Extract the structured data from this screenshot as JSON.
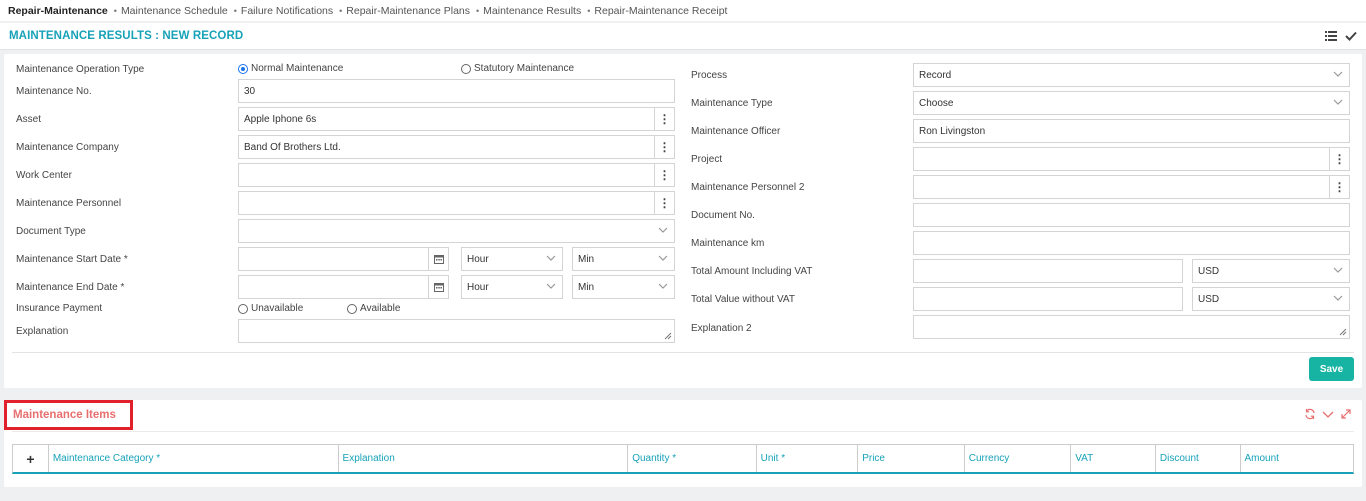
{
  "breadcrumbs": [
    {
      "label": "Repair-Maintenance"
    },
    {
      "label": "Maintenance Schedule"
    },
    {
      "label": "Failure Notifications"
    },
    {
      "label": "Repair-Maintenance Plans"
    },
    {
      "label": "Maintenance Results"
    },
    {
      "label": "Repair-Maintenance Receipt"
    }
  ],
  "header": {
    "title": "MAINTENANCE RESULTS : NEW RECORD"
  },
  "form": {
    "op_type_label": "Maintenance Operation Type",
    "op_type_normal": "Normal Maintenance",
    "op_type_statutory": "Statutory Maintenance",
    "maint_no_label": "Maintenance No.",
    "maint_no_value": "30",
    "asset_label": "Asset",
    "asset_value": "Apple Iphone 6s",
    "company_label": "Maintenance Company",
    "company_value": "Band Of Brothers Ltd.",
    "work_center_label": "Work Center",
    "personnel_label": "Maintenance Personnel",
    "doc_type_label": "Document Type",
    "start_date_label": "Maintenance Start Date *",
    "end_date_label": "Maintenance End Date *",
    "hour_placeholder": "Hour",
    "min_placeholder": "Min",
    "insurance_label": "Insurance Payment",
    "insurance_unavailable": "Unavailable",
    "insurance_available": "Available",
    "explanation_label": "Explanation",
    "process_label": "Process",
    "process_value": "Record",
    "maint_type_label": "Maintenance Type",
    "maint_type_value": "Choose",
    "officer_label": "Maintenance Officer",
    "officer_value": "Ron Livingston",
    "project_label": "Project",
    "personnel2_label": "Maintenance Personnel 2",
    "doc_no_label": "Document No.",
    "km_label": "Maintenance km",
    "total_vat_label": "Total Amount Including VAT",
    "total_novat_label": "Total Value without VAT",
    "currency_value": "USD",
    "explanation2_label": "Explanation 2",
    "save_label": "Save"
  },
  "items": {
    "title": "Maintenance Items",
    "columns": [
      {
        "label": "Maintenance Category *"
      },
      {
        "label": "Explanation"
      },
      {
        "label": "Quantity *"
      },
      {
        "label": "Unit *"
      },
      {
        "label": "Price"
      },
      {
        "label": "Currency"
      },
      {
        "label": "VAT"
      },
      {
        "label": "Discount"
      },
      {
        "label": "Amount"
      }
    ]
  },
  "colors": {
    "accent": "#17a2b8",
    "save": "#17b3a3",
    "items_title": "#e86f6f",
    "highlight": "#e0202a"
  }
}
